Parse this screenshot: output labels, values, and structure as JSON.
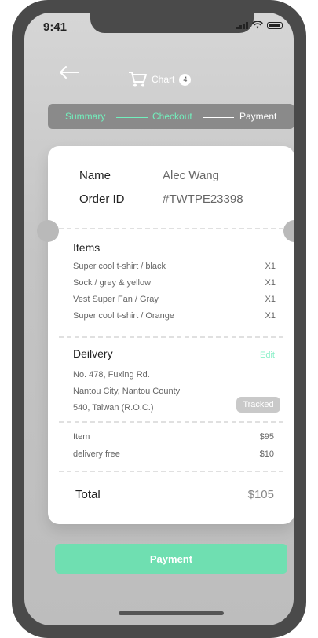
{
  "status": {
    "time": "9:41"
  },
  "header": {
    "cart_label": "Chart",
    "cart_count": "4"
  },
  "steps": [
    {
      "label": "Summary",
      "active": true
    },
    {
      "label": "Checkout",
      "active": true
    },
    {
      "label": "Payment",
      "active": false
    }
  ],
  "order": {
    "name_label": "Name",
    "name_value": "Alec Wang",
    "id_label": "Order ID",
    "id_value": "#TWTPE23398"
  },
  "items": {
    "title": "Items",
    "list": [
      {
        "name": "Super cool t-shirt / black",
        "qty": "X1"
      },
      {
        "name": "Sock / grey & yellow",
        "qty": "X1"
      },
      {
        "name": "Vest Super Fan / Gray",
        "qty": "X1"
      },
      {
        "name": "Super cool t-shirt / Orange",
        "qty": "X1"
      }
    ]
  },
  "delivery": {
    "title": "Deilvery",
    "edit_label": "Edit",
    "address_lines": [
      "No. 478, Fuxing Rd.",
      "Nantou City, Nantou County",
      "540, Taiwan (R.O.C.)"
    ],
    "status_badge": "Tracked"
  },
  "summary": {
    "rows": [
      {
        "label": "Item",
        "value": "$95"
      },
      {
        "label": "delivery free",
        "value": "$10"
      }
    ],
    "total_label": "Total",
    "total_value": "$105"
  },
  "payment_button": "Payment",
  "colors": {
    "accent": "#72f0bd",
    "button": "#6fdfb1",
    "frame": "#4a4a4a"
  }
}
